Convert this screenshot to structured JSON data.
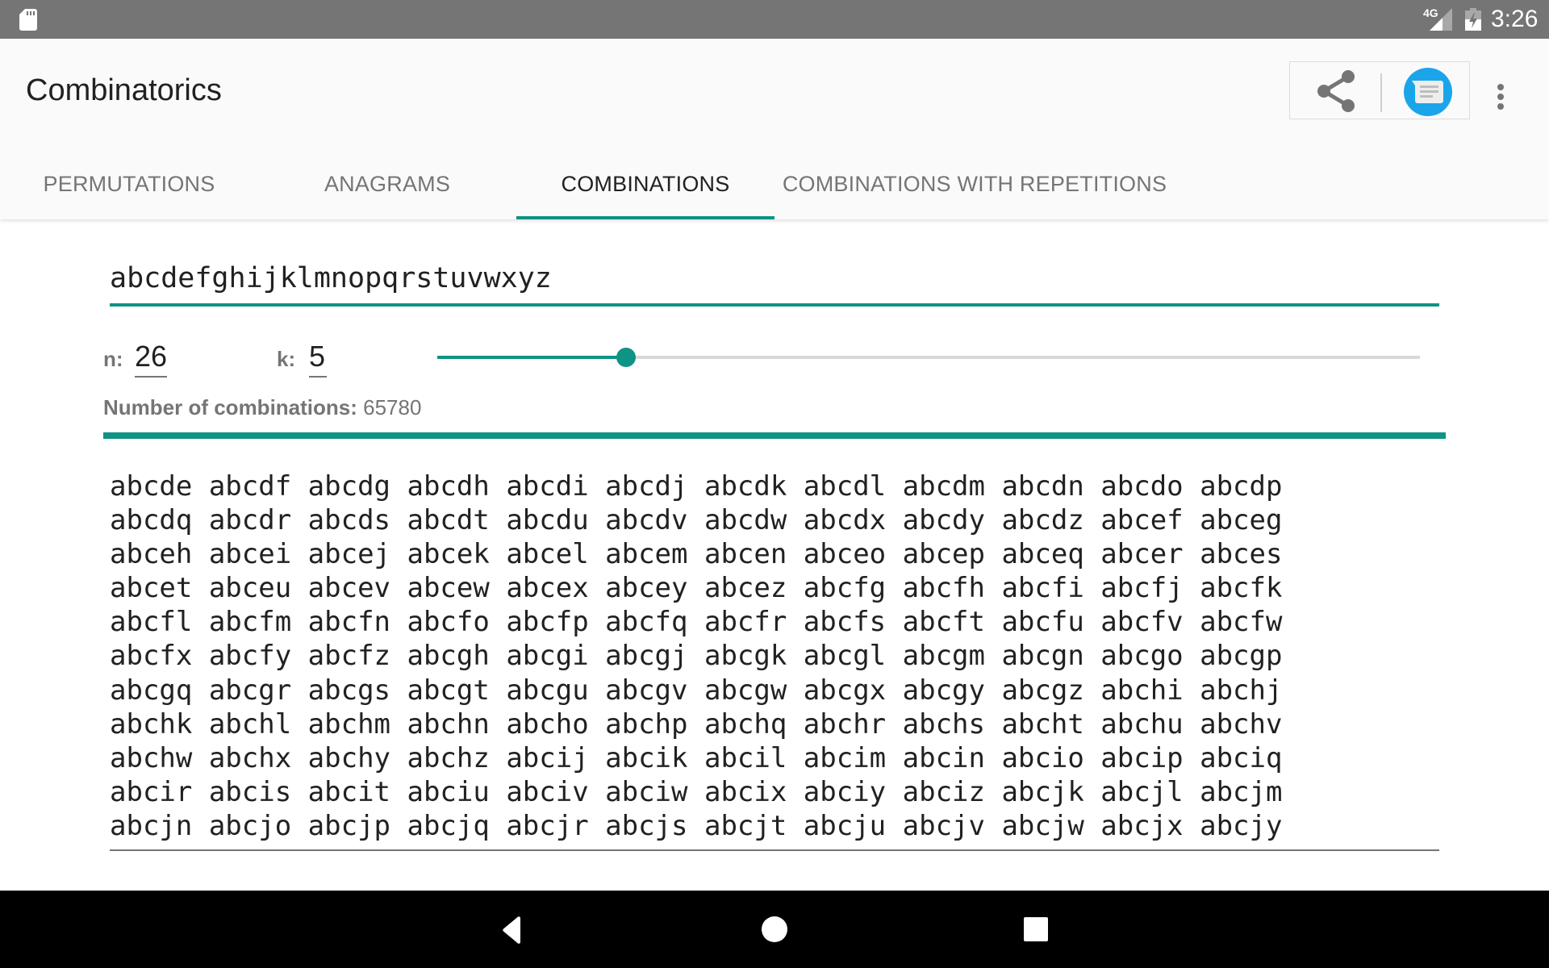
{
  "status_bar": {
    "left_icons": [
      "sd-card-icon"
    ],
    "network_label": "4G",
    "right_icons": [
      "signal-icon",
      "battery-charging-icon"
    ],
    "time": "3:26"
  },
  "app_bar": {
    "title": "Combinatorics",
    "actions": [
      {
        "name": "share",
        "icon": "share-icon"
      },
      {
        "name": "messages",
        "icon": "messages-icon"
      },
      {
        "name": "more-options",
        "icon": "more-vert-icon"
      }
    ]
  },
  "tabs": [
    {
      "label": "PERMUTATIONS",
      "active": false
    },
    {
      "label": "ANAGRAMS",
      "active": false
    },
    {
      "label": "COMBINATIONS",
      "active": true
    },
    {
      "label": "COMBINATIONS WITH REPETITIONS",
      "active": false
    }
  ],
  "colors": {
    "accent": "#0f9384",
    "status_bar": "#757575",
    "header_bg": "#fafafa",
    "messages_blue": "#1aa5ea"
  },
  "input": {
    "value": "abcdefghijklmnopqrstuvwxyz"
  },
  "params": {
    "n_label": "n:",
    "n_value": "26",
    "k_label": "k:",
    "k_value": "5",
    "slider": {
      "min": 0,
      "max": 26,
      "value": 5
    }
  },
  "count": {
    "label": "Number of combinations:",
    "value": "65780"
  },
  "progress_fraction": 1.0,
  "results": {
    "per_row": 12,
    "items": [
      "abcde",
      "abcdf",
      "abcdg",
      "abcdh",
      "abcdi",
      "abcdj",
      "abcdk",
      "abcdl",
      "abcdm",
      "abcdn",
      "abcdo",
      "abcdp",
      "abcdq",
      "abcdr",
      "abcds",
      "abcdt",
      "abcdu",
      "abcdv",
      "abcdw",
      "abcdx",
      "abcdy",
      "abcdz",
      "abcef",
      "abceg",
      "abceh",
      "abcei",
      "abcej",
      "abcek",
      "abcel",
      "abcem",
      "abcen",
      "abceo",
      "abcep",
      "abceq",
      "abcer",
      "abces",
      "abcet",
      "abceu",
      "abcev",
      "abcew",
      "abcex",
      "abcey",
      "abcez",
      "abcfg",
      "abcfh",
      "abcfi",
      "abcfj",
      "abcfk",
      "abcfl",
      "abcfm",
      "abcfn",
      "abcfo",
      "abcfp",
      "abcfq",
      "abcfr",
      "abcfs",
      "abcft",
      "abcfu",
      "abcfv",
      "abcfw",
      "abcfx",
      "abcfy",
      "abcfz",
      "abcgh",
      "abcgi",
      "abcgj",
      "abcgk",
      "abcgl",
      "abcgm",
      "abcgn",
      "abcgo",
      "abcgp",
      "abcgq",
      "abcgr",
      "abcgs",
      "abcgt",
      "abcgu",
      "abcgv",
      "abcgw",
      "abcgx",
      "abcgy",
      "abcgz",
      "abchi",
      "abchj",
      "abchk",
      "abchl",
      "abchm",
      "abchn",
      "abcho",
      "abchp",
      "abchq",
      "abchr",
      "abchs",
      "abcht",
      "abchu",
      "abchv",
      "abchw",
      "abchx",
      "abchy",
      "abchz",
      "abcij",
      "abcik",
      "abcil",
      "abcim",
      "abcin",
      "abcio",
      "abcip",
      "abciq",
      "abcir",
      "abcis",
      "abcit",
      "abciu",
      "abciv",
      "abciw",
      "abcix",
      "abciy",
      "abciz",
      "abcjk",
      "abcjl",
      "abcjm",
      "abcjn",
      "abcjo",
      "abcjp",
      "abcjq",
      "abcjr",
      "abcjs",
      "abcjt",
      "abcju",
      "abcjv",
      "abcjw",
      "abcjx",
      "abcjy"
    ]
  },
  "nav_bar": {
    "buttons": [
      "back-icon",
      "home-icon",
      "recents-icon"
    ]
  }
}
